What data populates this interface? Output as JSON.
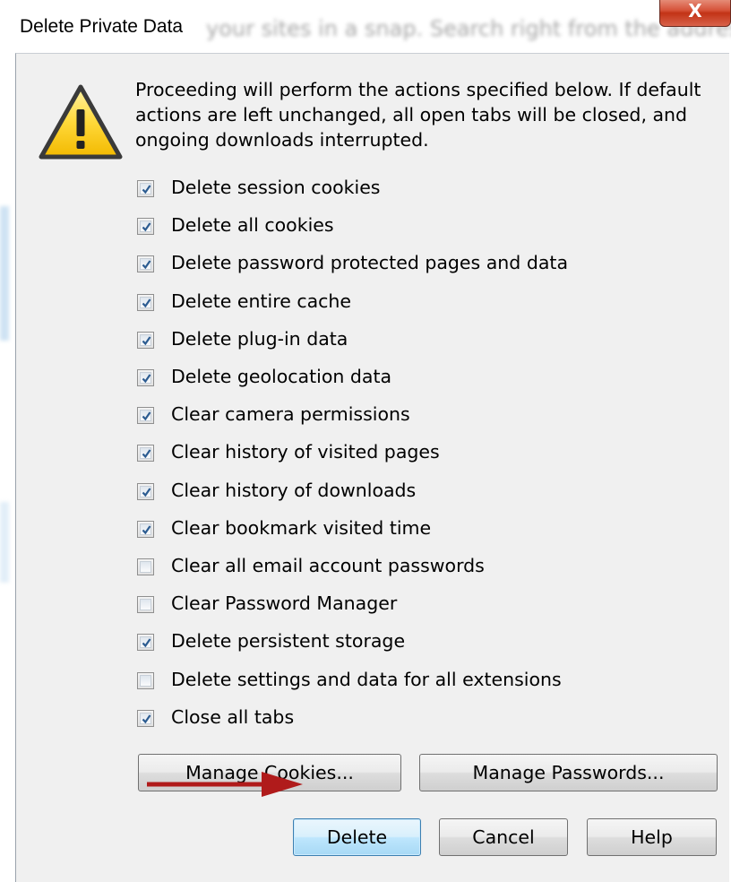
{
  "window": {
    "title": "Delete Private Data",
    "close_glyph": "X",
    "background_text": "your sites in a snap. Search right from the address"
  },
  "message": "Proceeding will perform the actions specified below. If default actions are left unchanged, all open tabs will be closed, and ongoing downloads interrupted.",
  "icons": {
    "warning": "warning-triangle-icon",
    "checkmark": "checkmark-icon",
    "arrow": "red-arrow-annotation"
  },
  "options": [
    {
      "label": "Delete session cookies",
      "checked": true
    },
    {
      "label": "Delete all cookies",
      "checked": true
    },
    {
      "label": "Delete password protected pages and data",
      "checked": true
    },
    {
      "label": "Delete entire cache",
      "checked": true
    },
    {
      "label": "Delete plug-in data",
      "checked": true
    },
    {
      "label": "Delete geolocation data",
      "checked": true
    },
    {
      "label": "Clear camera permissions",
      "checked": true
    },
    {
      "label": "Clear history of visited pages",
      "checked": true
    },
    {
      "label": "Clear history of downloads",
      "checked": true
    },
    {
      "label": "Clear bookmark visited time",
      "checked": true
    },
    {
      "label": "Clear all email account passwords",
      "checked": false
    },
    {
      "label": "Clear Password Manager",
      "checked": false
    },
    {
      "label": "Delete persistent storage",
      "checked": true
    },
    {
      "label": "Delete settings and data for all extensions",
      "checked": false
    },
    {
      "label": "Close all tabs",
      "checked": true
    }
  ],
  "buttons": {
    "manage_cookies": "Manage Cookies...",
    "manage_passwords": "Manage Passwords...",
    "delete": "Delete",
    "cancel": "Cancel",
    "help": "Help"
  },
  "colors": {
    "dialog_bg": "#f0f0f0",
    "close_button": "#c23316",
    "warning_fill": "#ffd42a",
    "arrow": "#b01b1b",
    "default_button_border": "#3c7fb1"
  }
}
